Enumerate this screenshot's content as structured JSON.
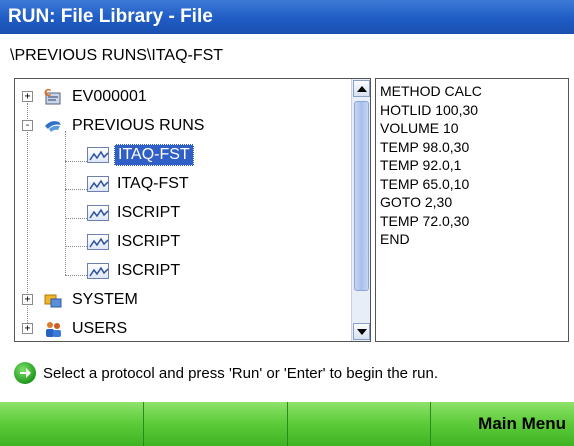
{
  "window": {
    "title": "RUN: File Library - File"
  },
  "path": "\\PREVIOUS RUNS\\ITAQ-FST",
  "tree": {
    "nodes": [
      {
        "label": "EV000001",
        "icon": "document-c-icon",
        "expander": "+"
      },
      {
        "label": "PREVIOUS RUNS",
        "icon": "runs-folder-icon",
        "expander": "-"
      },
      {
        "label": "ITAQ-FST",
        "icon": "protocol-graph-icon",
        "selected": true
      },
      {
        "label": "ITAQ-FST",
        "icon": "protocol-graph-icon"
      },
      {
        "label": "ISCRIPT",
        "icon": "protocol-graph-icon"
      },
      {
        "label": "ISCRIPT",
        "icon": "protocol-graph-icon"
      },
      {
        "label": "ISCRIPT",
        "icon": "protocol-graph-icon"
      },
      {
        "label": "SYSTEM",
        "icon": "system-folder-icon",
        "expander": "+"
      },
      {
        "label": "USERS",
        "icon": "users-icon",
        "expander": "+"
      }
    ]
  },
  "detail": {
    "lines": [
      "METHOD CALC",
      "HOTLID 100,30",
      "VOLUME 10",
      "TEMP 98.0,30",
      "TEMP 92.0,1",
      "TEMP 65.0,10",
      "GOTO 2,30",
      "TEMP 72.0,30",
      "END"
    ]
  },
  "hint": "Select a protocol and press 'Run' or 'Enter' to begin the run.",
  "softkeys": [
    "",
    "",
    "",
    "Main Menu"
  ],
  "colors": {
    "titlebar": "#1f5cc4",
    "selection": "#2f5fc7",
    "softkey": "#5fcd3c"
  }
}
